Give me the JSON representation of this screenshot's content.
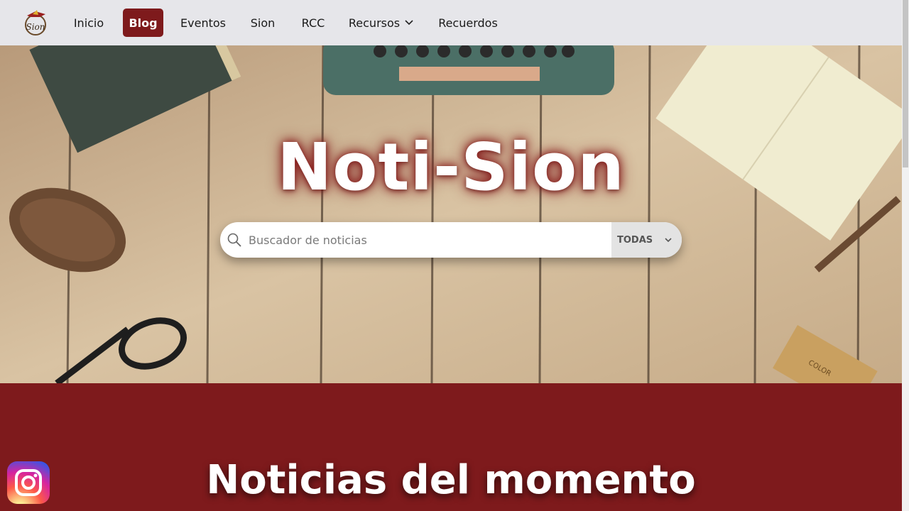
{
  "nav": {
    "logo_alt": "Sion",
    "items": [
      {
        "label": "Inicio",
        "active": false
      },
      {
        "label": "Blog",
        "active": true
      },
      {
        "label": "Eventos",
        "active": false
      },
      {
        "label": "Sion",
        "active": false
      },
      {
        "label": "RCC",
        "active": false
      },
      {
        "label": "Recursos",
        "active": false,
        "dropdown": true
      },
      {
        "label": "Recuerdos",
        "active": false
      }
    ]
  },
  "hero": {
    "title": "Noti-Sion",
    "search": {
      "placeholder": "Buscador de noticias",
      "value": "",
      "filter_selected": "TODAS"
    }
  },
  "section": {
    "title": "Noticias del momento"
  },
  "social": {
    "icon": "instagram-icon"
  },
  "colors": {
    "brand": "#7e1a1c",
    "navbar_bg": "#e6e6ea"
  }
}
